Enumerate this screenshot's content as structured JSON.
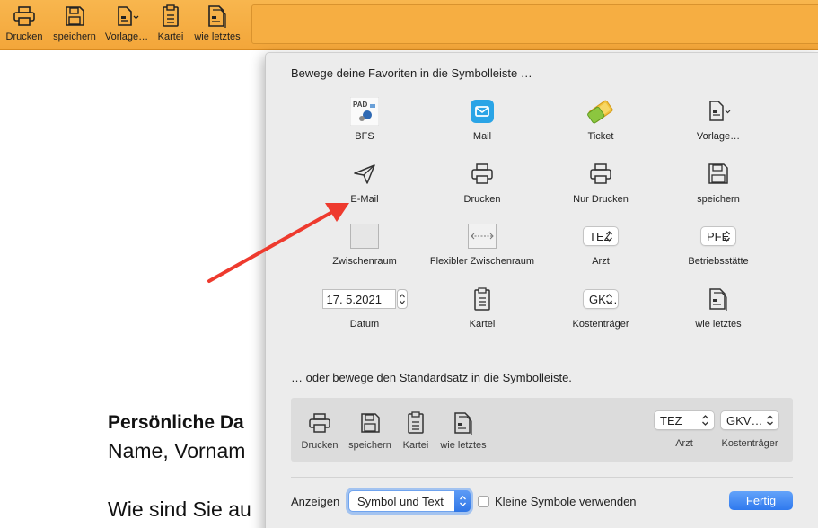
{
  "toolbar": {
    "items": [
      {
        "label": "Drucken",
        "icon": "printer-icon"
      },
      {
        "label": "speichern",
        "icon": "floppy-disk-icon"
      },
      {
        "label": "Vorlage…",
        "icon": "template-icon"
      },
      {
        "label": "Kartei",
        "icon": "clipboard-icon"
      },
      {
        "label": "wie letztes",
        "icon": "copy-document-icon"
      }
    ]
  },
  "document": {
    "heading": "Persönliche Da",
    "line1": "Name, Vornam",
    "line2": "Wie sind Sie au"
  },
  "sheet": {
    "title": "Bewege deine Favoriten in die Symbolleiste …",
    "favorites": [
      {
        "label": "BFS",
        "icon": "bfs-app-icon"
      },
      {
        "label": "Mail",
        "icon": "mail-app-icon"
      },
      {
        "label": "Ticket",
        "icon": "ticket-icon"
      },
      {
        "label": "Vorlage…",
        "icon": "template-icon"
      },
      {
        "label": "E-Mail",
        "icon": "paper-plane-icon"
      },
      {
        "label": "Drucken",
        "icon": "printer-icon"
      },
      {
        "label": "Nur Drucken",
        "icon": "printer-icon"
      },
      {
        "label": "speichern",
        "icon": "floppy-disk-icon"
      },
      {
        "label": "Zwischenraum",
        "icon": "space-icon"
      },
      {
        "label": "Flexibler Zwischenraum",
        "icon": "flexible-space-icon"
      },
      {
        "label": "Arzt",
        "value": "TEZ"
      },
      {
        "label": "Betriebsstätte",
        "value": "PFE"
      },
      {
        "label": "Datum",
        "value": "17.  5.2021"
      },
      {
        "label": "Kartei",
        "icon": "clipboard-icon"
      },
      {
        "label": "Kostenträger",
        "value": "GK…"
      },
      {
        "label": "wie letztes",
        "icon": "copy-document-icon"
      }
    ],
    "subtitle": "… oder bewege den Standardsatz in die Symbolleiste.",
    "default_set": [
      {
        "label": "Drucken",
        "icon": "printer-icon"
      },
      {
        "label": "speichern",
        "icon": "floppy-disk-icon"
      },
      {
        "label": "Kartei",
        "icon": "clipboard-icon"
      },
      {
        "label": "wie letztes",
        "icon": "copy-document-icon"
      },
      {
        "label": "Arzt",
        "value": "TEZ"
      },
      {
        "label": "Kostenträger",
        "value": "GKV…"
      }
    ],
    "footer": {
      "show_label": "Anzeigen",
      "show_value": "Symbol und Text",
      "small_icons_label": "Kleine Symbole verwenden",
      "small_icons_checked": false,
      "done_label": "Fertig"
    }
  },
  "colors": {
    "toolbar": "#f5aa3f",
    "accent": "#2f79ee",
    "arrow": "#ee3a2e"
  }
}
